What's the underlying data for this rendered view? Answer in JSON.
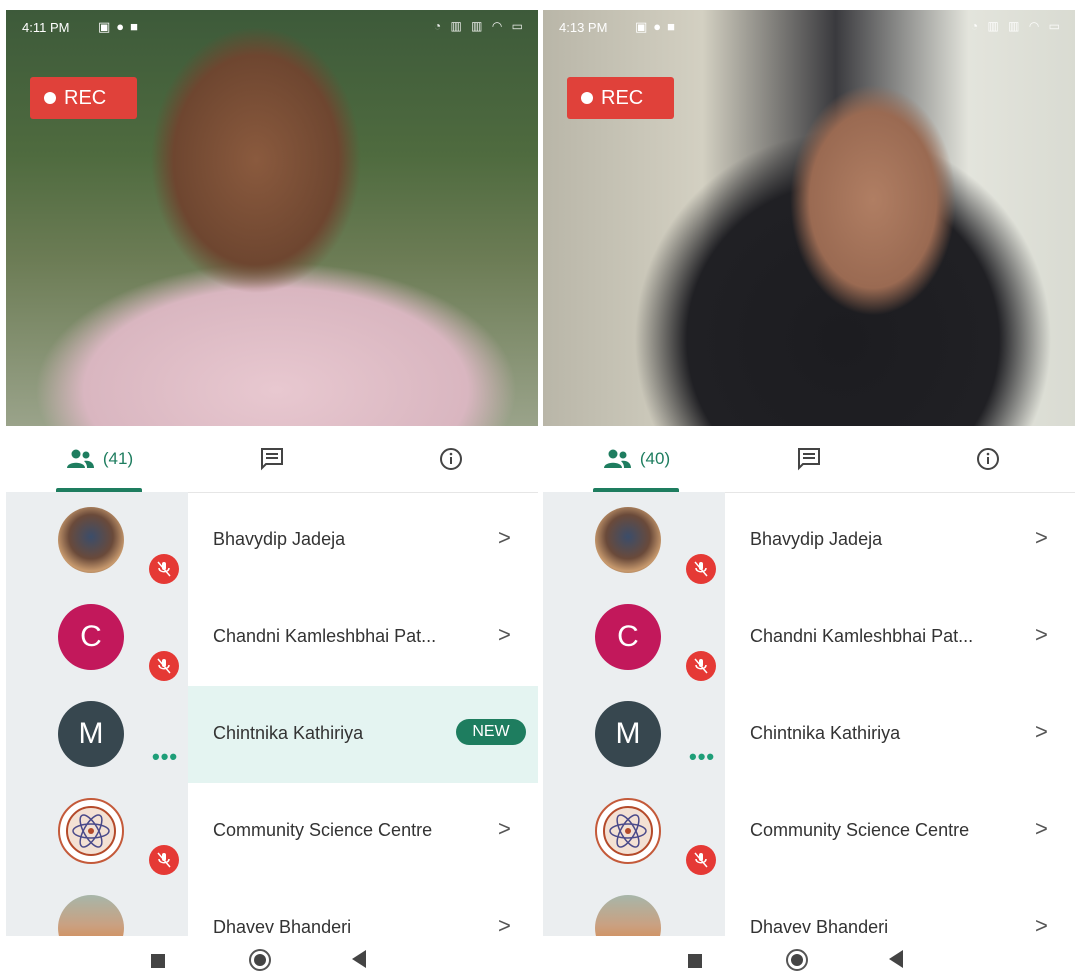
{
  "colors": {
    "accent": "#1e7d5f",
    "rec": "#e0413a",
    "mute": "#e53935",
    "highlight": "#e4f4f1"
  },
  "panels": [
    {
      "status_time": "4:11 PM",
      "rec_label": "REC",
      "participants_count": "(41)",
      "participants": [
        {
          "name": "Bhavydip Jadeja",
          "avatar": "photo",
          "status": "muted",
          "trailing": ">"
        },
        {
          "name": "Chandni Kamleshbhai Pat...",
          "avatar": "C",
          "status": "muted",
          "trailing": ">"
        },
        {
          "name": "Chintnika Kathiriya",
          "avatar": "M",
          "status": "typing",
          "trailing": "NEW"
        },
        {
          "name": "Community Science Centre",
          "avatar": "logo",
          "status": "muted",
          "trailing": ">"
        },
        {
          "name": "Dhavev Bhanderi",
          "avatar": "photo",
          "status": "",
          "trailing": ">"
        }
      ]
    },
    {
      "status_time": "4:13 PM",
      "rec_label": "REC",
      "participants_count": "(40)",
      "participants": [
        {
          "name": "Bhavydip Jadeja",
          "avatar": "photo",
          "status": "muted",
          "trailing": ">"
        },
        {
          "name": "Chandni Kamleshbhai Pat...",
          "avatar": "C",
          "status": "muted",
          "trailing": ">"
        },
        {
          "name": "Chintnika Kathiriya",
          "avatar": "M",
          "status": "typing",
          "trailing": ">"
        },
        {
          "name": "Community Science Centre",
          "avatar": "logo",
          "status": "muted",
          "trailing": ">"
        },
        {
          "name": "Dhavev Bhanderi",
          "avatar": "photo",
          "status": "",
          "trailing": ">"
        }
      ]
    }
  ],
  "icons": {
    "people": "people-icon",
    "chat": "chat-icon",
    "info": "info-icon",
    "mute": "mic-off-icon",
    "nav": [
      "recents-icon",
      "home-icon",
      "back-icon"
    ]
  }
}
